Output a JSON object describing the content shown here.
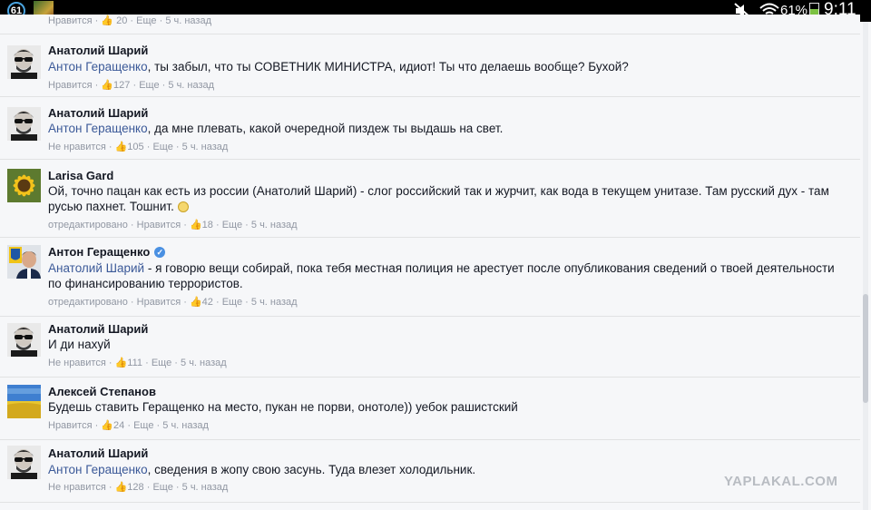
{
  "status_bar": {
    "notification_count": "61",
    "battery_percent": "61%",
    "time": "9:11",
    "battery_level": 0.61,
    "icons": [
      "notification-badge-icon",
      "photo-notification-icon",
      "mute-icon",
      "wifi-icon",
      "battery-icon"
    ]
  },
  "top_partial": {
    "meta": [
      "Нравится",
      "20",
      "Еще",
      "5 ч. назад"
    ]
  },
  "comments": [
    {
      "author": "Анатолий Шарий",
      "mention": "Антон Геращенко",
      "text": ", ты забыл, что ты СОВЕТНИК МИНИСТРА, идиот! Ты что делаешь вообще? Бухой?",
      "edited": "",
      "like_label": "Нравится",
      "likes": "127",
      "more": "Еще",
      "time": "5 ч. назад"
    },
    {
      "author": "Анатолий Шарий",
      "mention": "Антон Геращенко",
      "text": ", да мне плевать, какой очередной пиздеж ты выдашь на свет.",
      "edited": "",
      "like_label": "Не нравится",
      "likes": "105",
      "more": "Еще",
      "time": "5 ч. назад"
    },
    {
      "author": "Larisa Gard",
      "mention": "",
      "text": "Ой, точно пацан как есть из россии (Анатолий Шарий) - слог российский так и журчит, как вода в текущем унитазе. Там русский дух - там русью пахнет. Тошнит.",
      "edited": "отредактировано",
      "like_label": "Нравится",
      "likes": "18",
      "more": "Еще",
      "time": "5 ч. назад"
    },
    {
      "author": "Антон Геращенко",
      "mention": "Анатолий Шарий",
      "text": " - я говорю вещи собирай, пока тебя местная полиция не арестует после опубликования сведений о твоей деятельности по финансированию террористов.",
      "edited": "отредактировано",
      "like_label": "Нравится",
      "likes": "42",
      "more": "Еще",
      "time": "5 ч. назад"
    },
    {
      "author": "Анатолий Шарий",
      "mention": "",
      "text": "И ди нахуй",
      "edited": "",
      "like_label": "Не нравится",
      "likes": "111",
      "more": "Еще",
      "time": "5 ч. назад"
    },
    {
      "author": "Алексей Степанов",
      "mention": "",
      "text": "Будешь ставить Геращенко на место, пукан не порви, онотоле)) уебок рашистский",
      "edited": "",
      "like_label": "Нравится",
      "likes": "24",
      "more": "Еще",
      "time": "5 ч. назад"
    },
    {
      "author": "Анатолий Шарий",
      "mention": "Антон Геращенко",
      "text": ", сведения в жопу свою засунь. Туда влезет холодильник.",
      "edited": "",
      "like_label": "Не нравится",
      "likes": "128",
      "more": "Еще",
      "time": "5 ч. назад"
    }
  ],
  "separator": "·",
  "watermark": "YAPLAKAL.COM",
  "colors": {
    "link": "#3b5998",
    "meta": "#9197a3",
    "text": "#141823",
    "background": "#f6f7f9",
    "verified": "#4a90e2"
  }
}
